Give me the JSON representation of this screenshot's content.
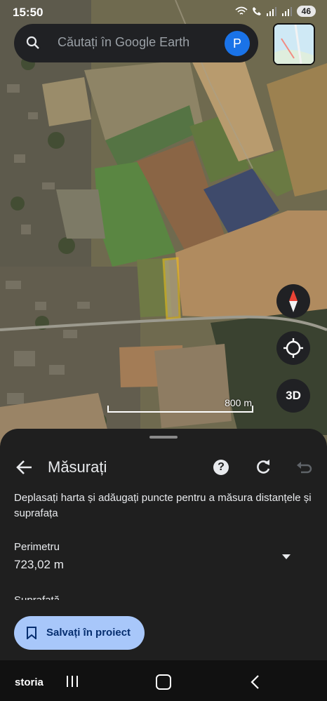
{
  "status_bar": {
    "time": "15:50",
    "battery": "46"
  },
  "search": {
    "placeholder": "Căutați în Google Earth",
    "avatar_letter": "P"
  },
  "map": {
    "scale_label": "800 m",
    "three_d_label": "3D",
    "highlight_color": "#f5c518"
  },
  "sheet": {
    "title": "Măsurați",
    "description": "Deplasați harta și adăugați puncte pentru a măsura distanțele și suprafața",
    "perimeter_label": "Perimetru",
    "perimeter_value": "723,02 m",
    "area_peek": "Suprafață",
    "save_button": "Salvați în proiect"
  },
  "nav": {
    "brand": "storia"
  },
  "colors": {
    "accent": "#a8c7fa",
    "avatar": "#1a73e8",
    "sheet_bg": "#1f1f1f"
  }
}
